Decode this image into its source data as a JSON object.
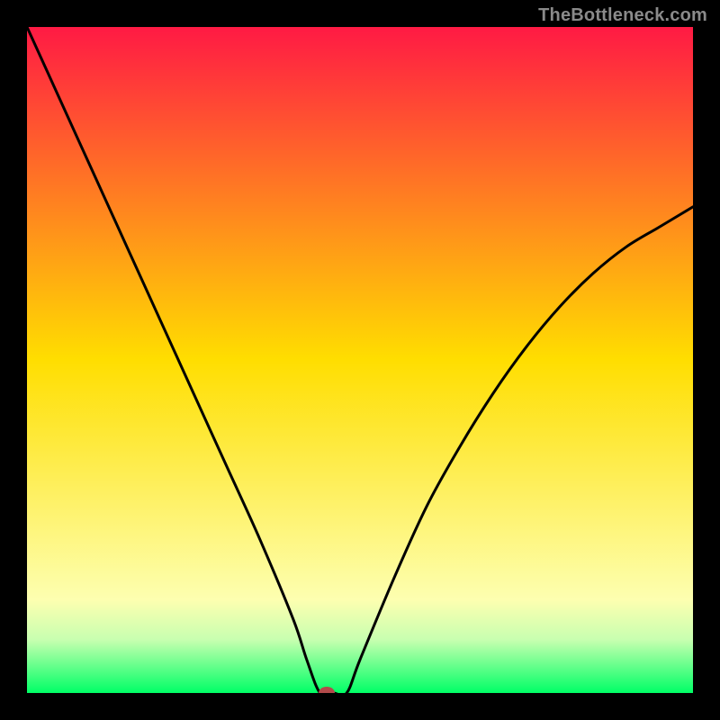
{
  "watermark_text": "TheBottleneck.com",
  "chart_data": {
    "type": "line",
    "title": "",
    "xlabel": "",
    "ylabel": "",
    "xlim": [
      0,
      100
    ],
    "ylim": [
      0,
      100
    ],
    "x": [
      0,
      5,
      10,
      15,
      20,
      25,
      30,
      35,
      40,
      42,
      44,
      46,
      48,
      50,
      55,
      60,
      65,
      70,
      75,
      80,
      85,
      90,
      95,
      100
    ],
    "y": [
      100,
      89,
      78,
      67,
      56,
      45,
      34,
      23,
      11,
      5,
      0,
      0,
      0,
      5,
      17,
      28,
      37,
      45,
      52,
      58,
      63,
      67,
      70,
      73
    ],
    "marker": {
      "x": 45,
      "y": 0,
      "color": "#b24a4a"
    },
    "gradient_stops": [
      {
        "offset": 0,
        "color": "#ff1a44"
      },
      {
        "offset": 0.5,
        "color": "#ffde00"
      },
      {
        "offset": 0.86,
        "color": "#fdffb0"
      },
      {
        "offset": 0.92,
        "color": "#c8ffb0"
      },
      {
        "offset": 1.0,
        "color": "#00ff66"
      }
    ],
    "curve_color": "#000000"
  }
}
